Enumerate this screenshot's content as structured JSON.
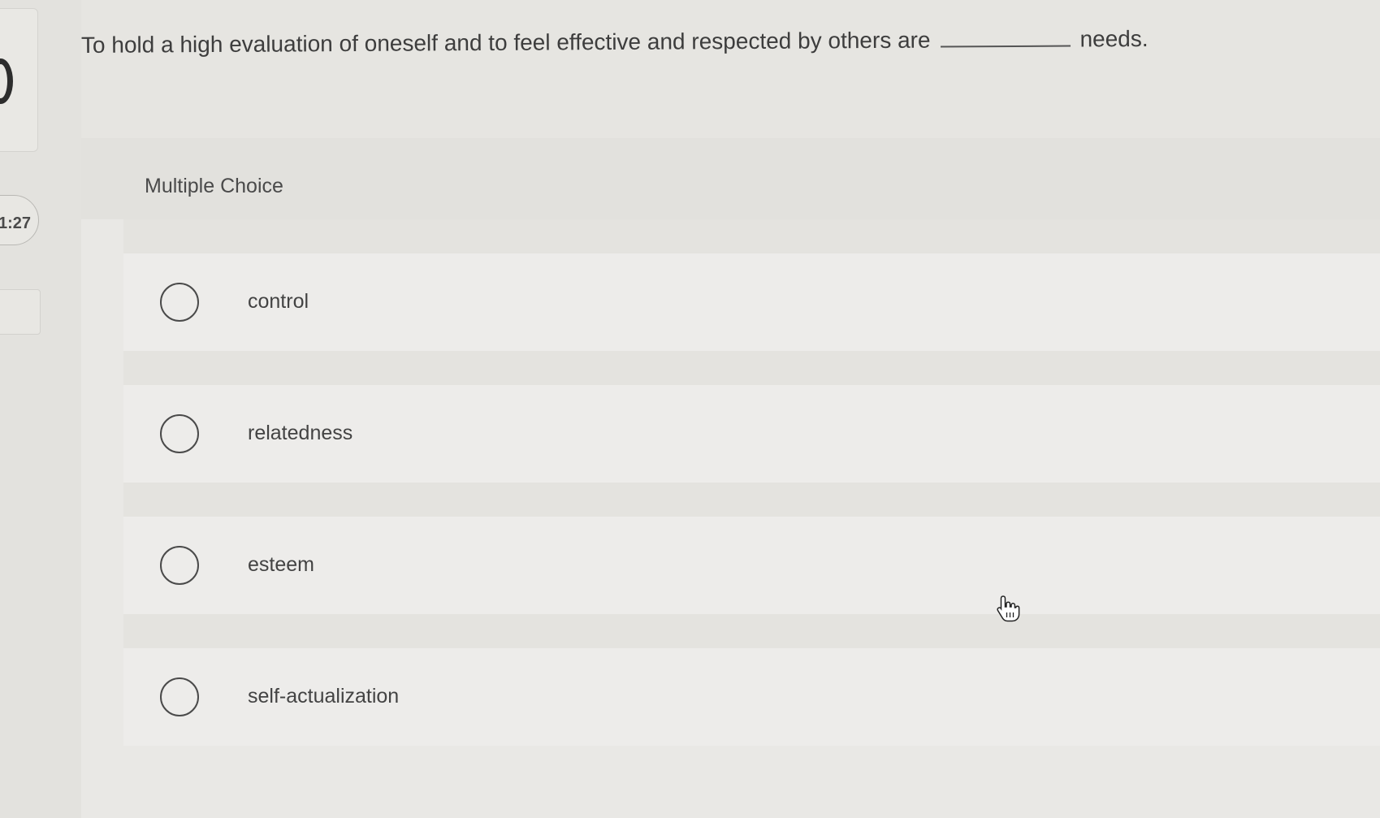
{
  "timer": {
    "text": "1:27"
  },
  "question": {
    "text_before": "To hold a high evaluation of oneself and to feel effective and respected by others are",
    "text_after": "needs."
  },
  "panel": {
    "label": "Multiple Choice"
  },
  "options": [
    {
      "label": "control",
      "selected": false
    },
    {
      "label": "relatedness",
      "selected": false
    },
    {
      "label": "esteem",
      "selected": false
    },
    {
      "label": "self-actualization",
      "selected": false
    }
  ],
  "icons": {
    "cursor": "hand-pointer-icon",
    "radio": "radio-unchecked-icon"
  },
  "colors": {
    "background": "#e6e5e1",
    "panel": "#e9e8e5",
    "text": "#3f3f3f"
  }
}
